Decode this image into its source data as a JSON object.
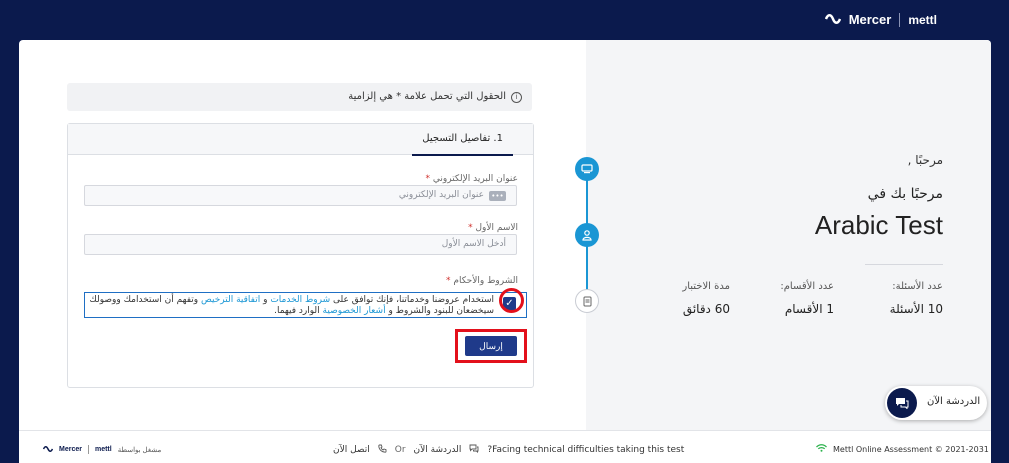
{
  "header": {
    "brand_primary": "Mercer",
    "brand_secondary": "mettl"
  },
  "welcome": {
    "greeting": "مرحبًا ,",
    "intro": "مرحبًا بك في",
    "test_title": "Arabic Test"
  },
  "stats": {
    "questions_label": "عدد الأسئلة:",
    "questions_value": "10 الأسئلة",
    "sections_label": "عدد الأقسام:",
    "sections_value": "1 الأقسام",
    "duration_label": "مدة الاختبار",
    "duration_value": "60  دقائق"
  },
  "form": {
    "required_notice": "الحقول التي تحمل علامة * هي إلزامية",
    "tab_label": "1. تفاصيل التسجيل",
    "email_label": "عنوان البريد الإلكتروني",
    "email_placeholder": "عنوان البريد الإلكتروني",
    "firstname_label": "الاسم الأول",
    "firstname_placeholder": "أدخل الاسم الأول",
    "terms_label": "الشروط والأحكام",
    "required_star": "*",
    "terms_checked": true,
    "terms_part1": "استخدام عروضنا وخدماتنا، فإنك توافق على ",
    "terms_link1": "شروط الخدمات",
    "terms_part2": " و ",
    "terms_link2": "اتفاقية الترخيص",
    "terms_part3": " وتفهم أن استخدامك ووصولك سيخضعان للبنود والشروط و ",
    "terms_link3": "أشعار الخصوصية",
    "terms_part4": " الوارد فيهما.",
    "submit_label": "إرسال"
  },
  "chat": {
    "label": "الدردشة الآن"
  },
  "footer": {
    "brand_primary": "Mercer",
    "brand_secondary": "mettl",
    "powered_by": "مشغل بواسطة",
    "call_label": "اتصل الآن",
    "or_label": "Or",
    "chat_label": "الدردشة الآن",
    "help_text": "?Facing technical difficulties taking this test",
    "copyright": "Mettl Online Assessment © 2021-2031"
  },
  "colors": {
    "navy": "#0b1a4d",
    "accent_blue": "#1a96d4",
    "button_blue": "#1f3a8a",
    "highlight_red": "#e3101b"
  }
}
